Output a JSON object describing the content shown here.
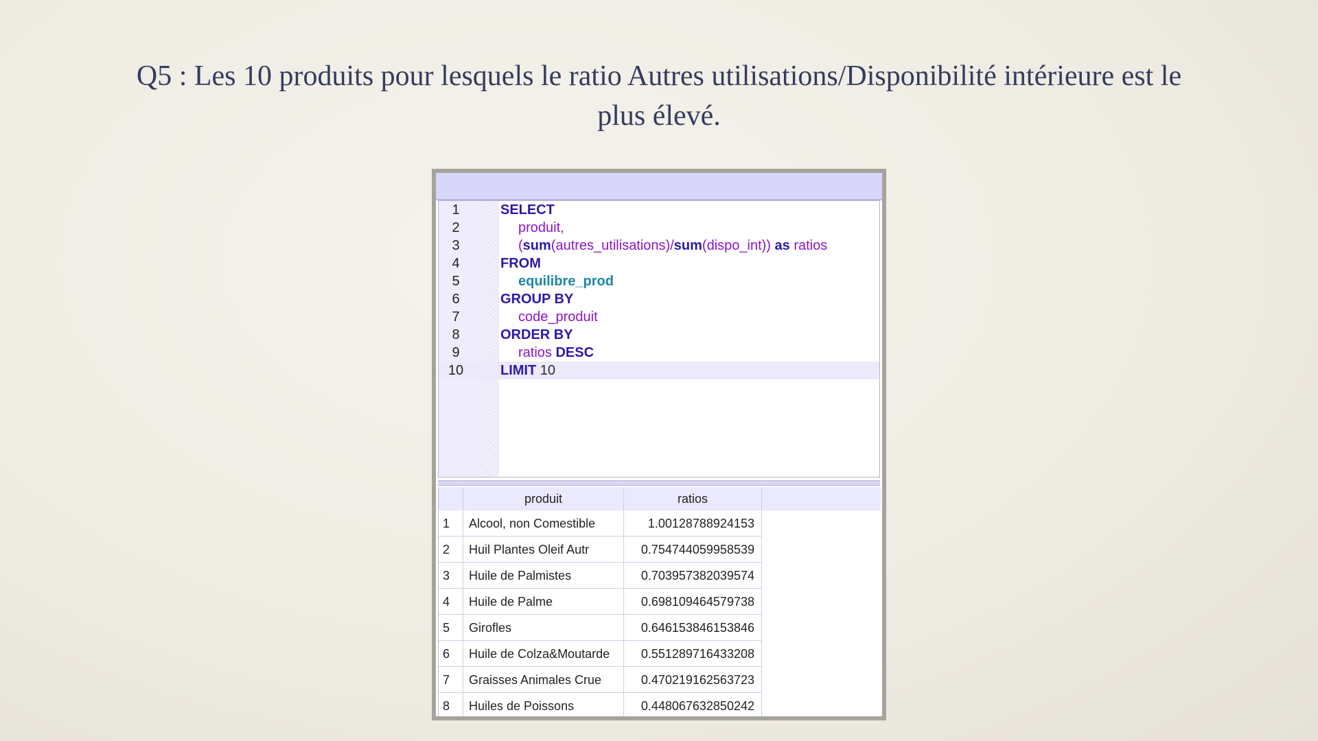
{
  "slide": {
    "title_line1": "Q5 : Les 10 produits pour lesquels le ratio Autres utilisations/Disponibilité intérieure est le",
    "title_line2": "plus élevé."
  },
  "editor": {
    "line_numbers": [
      "1",
      "2",
      "3",
      "4",
      "5",
      "6",
      "7",
      "8",
      "9",
      "10"
    ],
    "lines": {
      "l1_kw": "SELECT",
      "l2_id": "produit",
      "l2_pl": ",",
      "l3_p1": "(",
      "l3_sum1": "sum",
      "l3_p2": "(",
      "l3_col1": "autres_utilisations",
      "l3_p3": ")/",
      "l3_sum2": "sum",
      "l3_p4": "(",
      "l3_col2": "dispo_int",
      "l3_p5": ")) ",
      "l3_as": "as",
      "l3_alias": " ratios",
      "l4_kw": "FROM",
      "l5_table": "equilibre_prod",
      "l6_kw": "GROUP BY",
      "l7_id": "code_produit",
      "l8_kw": "ORDER BY",
      "l9_id": "ratios",
      "l9_kw": " DESC",
      "l10_kw": "LIMIT",
      "l10_val": " 10"
    }
  },
  "results": {
    "columns": [
      "produit",
      "ratios"
    ],
    "rows": [
      {
        "n": "1",
        "produit": "Alcool, non Comestible",
        "ratio": "1.00128788924153"
      },
      {
        "n": "2",
        "produit": "Huil Plantes Oleif Autr",
        "ratio": "0.754744059958539"
      },
      {
        "n": "3",
        "produit": "Huile de Palmistes",
        "ratio": "0.703957382039574"
      },
      {
        "n": "4",
        "produit": "Huile de Palme",
        "ratio": "0.698109464579738"
      },
      {
        "n": "5",
        "produit": "Girofles",
        "ratio": "0.646153846153846"
      },
      {
        "n": "6",
        "produit": "Huile de Colza&Moutarde",
        "ratio": "0.551289716433208"
      },
      {
        "n": "7",
        "produit": "Graisses Animales Crue",
        "ratio": "0.470219162563723"
      },
      {
        "n": "8",
        "produit": "Huiles de Poissons",
        "ratio": "0.448067632850242"
      }
    ]
  }
}
